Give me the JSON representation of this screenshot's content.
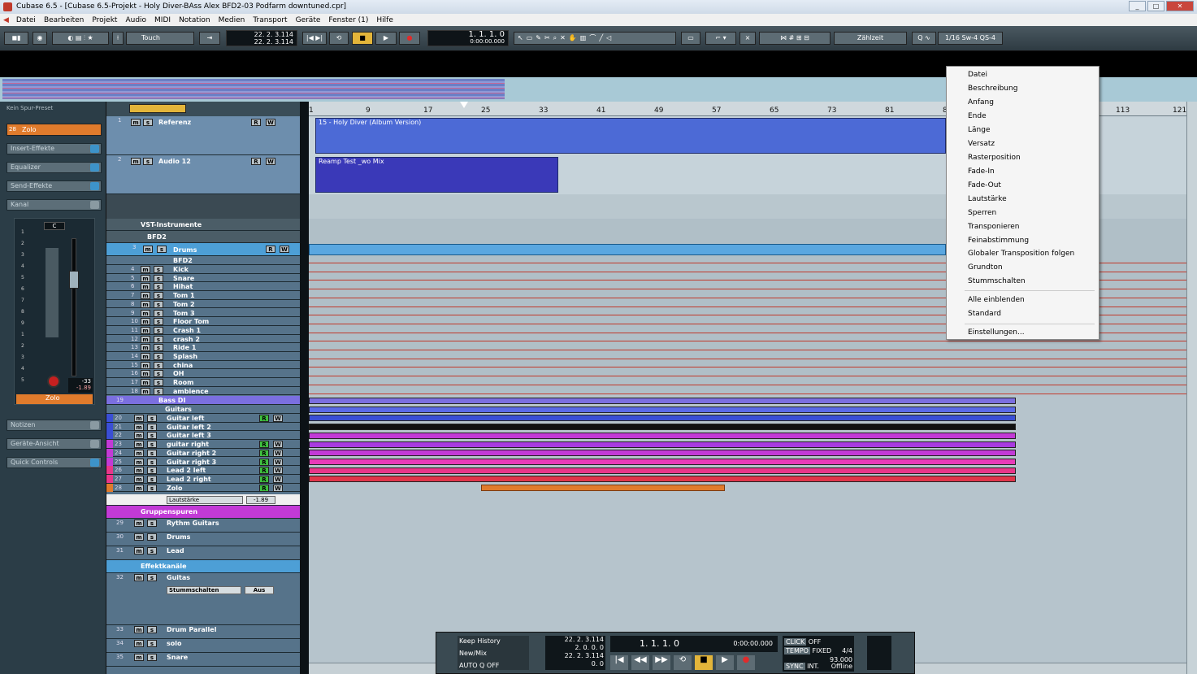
{
  "window": {
    "title": "Cubase 6.5 - [Cubase 6.5-Projekt - Holy Diver-BAss Alex BFD2-03 Podfarm downtuned.cpr]"
  },
  "menu": [
    "Datei",
    "Bearbeiten",
    "Projekt",
    "Audio",
    "MIDI",
    "Notation",
    "Medien",
    "Transport",
    "Geräte",
    "Fenster (1)",
    "Hilfe"
  ],
  "toolbar": {
    "automation_mode": "Touch",
    "pos1": "22. 2. 3.114",
    "pos2": "22. 2. 3.114",
    "position": "1. 1. 1.   0",
    "time": "0:00:00.000",
    "snap_type": "Zählzeit",
    "quantize": "1/16 Sw-4 QS-4"
  },
  "inspector": {
    "preset": "Kein Spur-Preset",
    "track_name": "Zolo",
    "track_num": "28",
    "sections": [
      "Insert-Effekte",
      "Equalizer",
      "Send-Effekte",
      "Kanal",
      "Notizen",
      "Geräte-Ansicht",
      "Quick Controls"
    ],
    "fader_value": "-33",
    "fader_value2": "-1.89",
    "channel_name": "Zolo",
    "pan": "C"
  },
  "ruler": [
    "1",
    "9",
    "17",
    "25",
    "33",
    "41",
    "49",
    "57",
    "65",
    "73",
    "81",
    "89",
    "97",
    "105",
    "113",
    "121"
  ],
  "tracks_top": [
    {
      "num": "1",
      "name": "Referenz"
    },
    {
      "num": "2",
      "name": "Audio 12"
    }
  ],
  "folder_vst": "VST-Instrumente",
  "folder_bfd": "BFD2",
  "drums_track": {
    "num": "3",
    "name": "Drums"
  },
  "bfd2_label": "BFD2",
  "drum_tracks": [
    {
      "num": "4",
      "name": "Kick"
    },
    {
      "num": "5",
      "name": "Snare"
    },
    {
      "num": "6",
      "name": "Hihat"
    },
    {
      "num": "7",
      "name": "Tom 1"
    },
    {
      "num": "8",
      "name": "Tom 2"
    },
    {
      "num": "9",
      "name": "Tom 3"
    },
    {
      "num": "10",
      "name": "Floor Tom"
    },
    {
      "num": "11",
      "name": "Crash 1"
    },
    {
      "num": "12",
      "name": "crash 2"
    },
    {
      "num": "13",
      "name": "Ride 1"
    },
    {
      "num": "14",
      "name": "Splash"
    },
    {
      "num": "15",
      "name": "china"
    },
    {
      "num": "16",
      "name": "OH"
    },
    {
      "num": "17",
      "name": "Room"
    },
    {
      "num": "18",
      "name": "ambience"
    }
  ],
  "bass_track": {
    "num": "19",
    "name": "Bass DI"
  },
  "guitars_folder": "Guitars",
  "guitar_tracks": [
    {
      "num": "20",
      "name": "Guitar left"
    },
    {
      "num": "21",
      "name": "Guitar left 2"
    },
    {
      "num": "22",
      "name": "Guitar left 3"
    },
    {
      "num": "23",
      "name": "guitar right"
    },
    {
      "num": "24",
      "name": "Guitar right 2"
    },
    {
      "num": "25",
      "name": "Guitar right 3"
    },
    {
      "num": "26",
      "name": "Lead 2 left"
    },
    {
      "num": "27",
      "name": "Lead 2 right"
    },
    {
      "num": "28",
      "name": "Zolo"
    }
  ],
  "zolo_auto": {
    "param": "Lautstärke",
    "value": "-1.89"
  },
  "group_folder": "Gruppenspuren",
  "group_tracks": [
    {
      "num": "29",
      "name": "Rythm Guitars"
    },
    {
      "num": "30",
      "name": "Drums"
    },
    {
      "num": "31",
      "name": "Lead"
    }
  ],
  "fx_folder": "Effektkanäle",
  "fx_tracks": [
    {
      "num": "32",
      "name": "Guitas"
    },
    {
      "num": "33",
      "name": "Drum Parallel"
    },
    {
      "num": "34",
      "name": "solo"
    },
    {
      "num": "35",
      "name": "Snare"
    }
  ],
  "fx_auto": {
    "param": "Stummschalten",
    "value": "Aus"
  },
  "clips": {
    "ref": "15 - Holy Diver (Album Version)",
    "audio12": "Reamp Test _wo Mix"
  },
  "context_menu": [
    "Datei",
    "Beschreibung",
    "Anfang",
    "Ende",
    "Länge",
    "Versatz",
    "Rasterposition",
    "Fade-In",
    "Fade-Out",
    "Lautstärke",
    "Sperren",
    "Transponieren",
    "Feinabstimmung",
    "Globaler Transposition folgen",
    "Grundton",
    "Stummschalten",
    "Alle einblenden",
    "Standard",
    "Einstellungen..."
  ],
  "transport": {
    "history": "Keep History",
    "mode": "New/Mix",
    "autoq": "AUTO Q",
    "autoq_state": "OFF",
    "l_pos": "22. 2. 3.114",
    "l_pos2": "2. 0. 0.  0",
    "r_pos": "22. 2. 3.114",
    "r_pos2": "0.  0",
    "main": "1. 1. 1.   0",
    "time": "0:00:00.000",
    "click": "CLICK",
    "click_state": "OFF",
    "tempo": "TEMPO",
    "tempo_mode": "FIXED",
    "sig": "4/4",
    "bpm": "93.000",
    "sync": "SYNC",
    "sync_mode": "INT.",
    "sync_state": "Offline"
  },
  "colors": {
    "guitar": "#7b6fe0",
    "lead": "#e8368a",
    "zolo": "#e07b2c",
    "ref_clip": "#4c6ad6",
    "reamp_clip": "#3a39b8"
  }
}
